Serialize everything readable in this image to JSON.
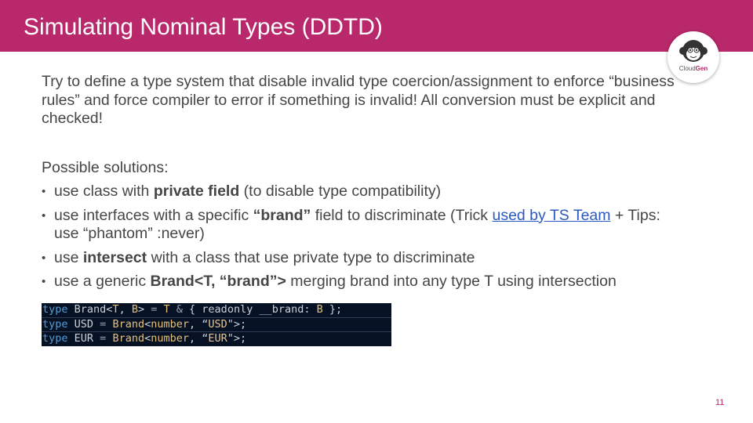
{
  "slide": {
    "title": "Simulating Nominal Types (DDTD)",
    "page_number": "11",
    "accent_color": "#b8286a"
  },
  "logo": {
    "name_part1": "Cloud",
    "name_part2": "Gen"
  },
  "body": {
    "intro": "Try to define a type system that disable invalid type coercion/assignment to enforce “business rules” and force compiler to error if something is invalid! All conversion must be explicit and checked!",
    "lead": "Possible solutions:",
    "bullets": [
      {
        "pre": "use class with ",
        "bold": "private field",
        "post": " (to disable type compatibility)"
      },
      {
        "pre": "use interfaces with a specific ",
        "bold": "“brand”",
        "post": " field to discriminate (Trick ",
        "link": "used by TS Team",
        "post2": "  + Tips: use “phantom” :never)"
      },
      {
        "pre": "use ",
        "bold": "intersect",
        "post": " with a class that use private type to discriminate"
      },
      {
        "pre": "use a generic ",
        "bold": "Brand<T, “brand”>",
        "post": " merging brand into any type T using intersection"
      }
    ]
  },
  "code": {
    "line1": {
      "kw": "type",
      "name": " Brand<",
      "t1": "T",
      "c1": ", ",
      "t2": "B",
      "c2": "> ",
      "eq": "=",
      "sp": " ",
      "t3": "T",
      "amp": " & ",
      "rest": "{ readonly __brand: ",
      "t4": "B",
      "end": " };"
    },
    "line2": {
      "kw": "type",
      "name": " USD ",
      "eq": "=",
      "sp": " ",
      "brand": "Brand",
      "lt": "<",
      "num": "number",
      "mid": ", “",
      "str": "USD",
      "end": "\">;"
    },
    "line3": {
      "kw": "type",
      "name": " EUR ",
      "eq": "=",
      "sp": " ",
      "brand": "Brand",
      "lt": "<",
      "num": "number",
      "mid": ", “",
      "str": "EUR",
      "end": "\">;"
    }
  }
}
